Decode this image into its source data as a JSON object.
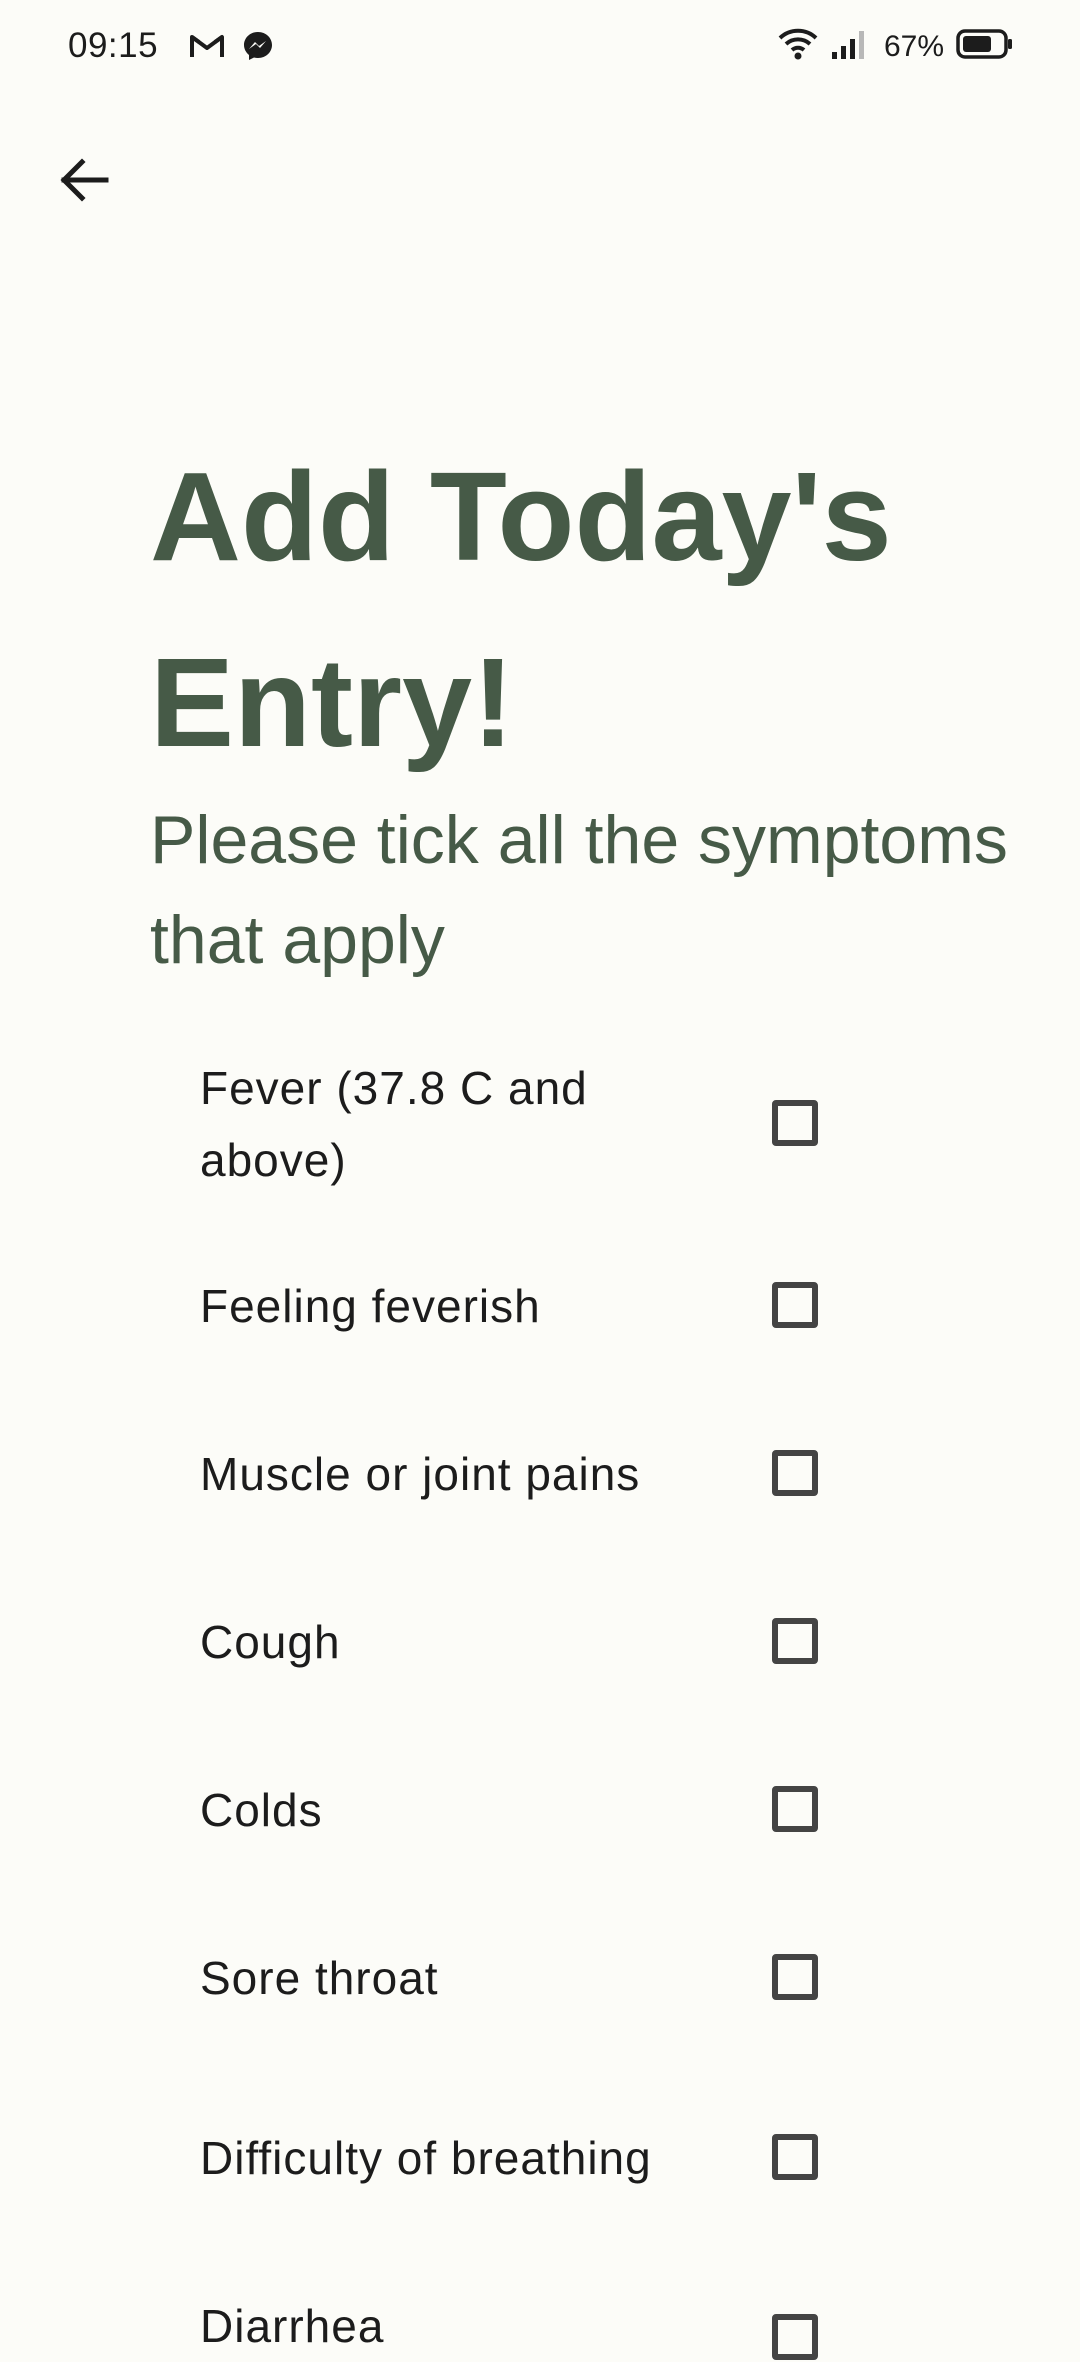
{
  "status_bar": {
    "time": "09:15",
    "left_icons": [
      "gmail-icon",
      "messenger-icon"
    ],
    "right_icons": [
      "wifi-icon",
      "signal-icon",
      "battery-icon"
    ],
    "battery_percent": "67%"
  },
  "header": {
    "back_icon": "arrow-left-icon"
  },
  "page": {
    "title": "Add Today's Entry!",
    "subtitle": "Please tick all the symptoms that apply"
  },
  "symptoms": [
    {
      "label": "Fever (37.8 C and above)",
      "checked": false
    },
    {
      "label": "Feeling feverish",
      "checked": false
    },
    {
      "label": "Muscle or joint pains",
      "checked": false
    },
    {
      "label": "Cough",
      "checked": false
    },
    {
      "label": "Colds",
      "checked": false
    },
    {
      "label": "Sore throat",
      "checked": false
    },
    {
      "label": "Difficulty of breathing",
      "checked": false
    },
    {
      "label": "Diarrhea",
      "checked": false
    }
  ],
  "colors": {
    "background": "#fcfcf8",
    "heading": "#465a47",
    "checkbox_border": "#444444"
  }
}
